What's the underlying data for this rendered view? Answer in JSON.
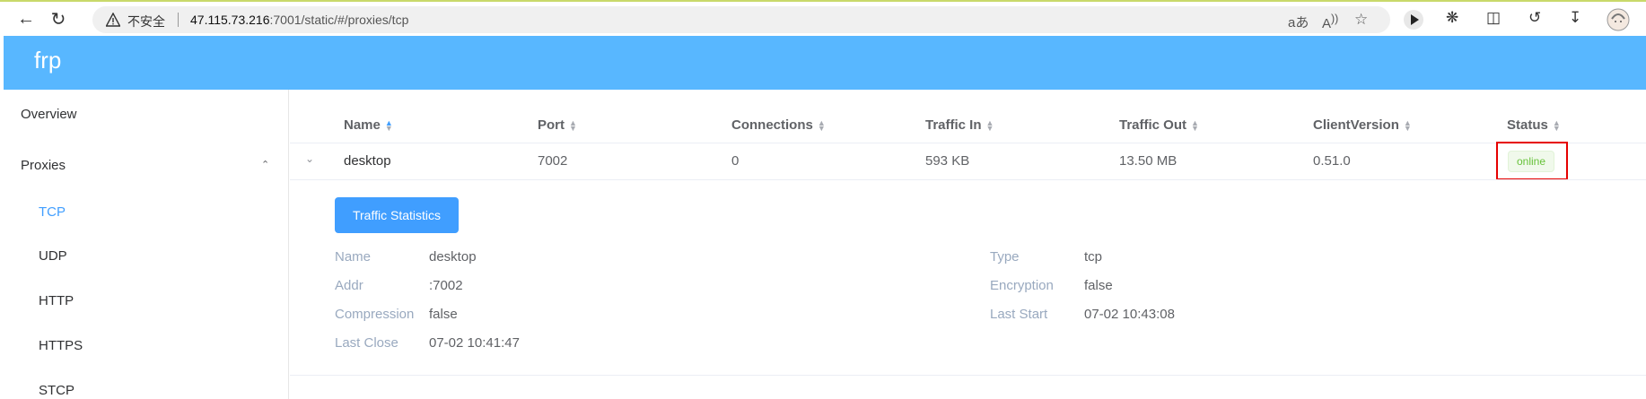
{
  "browser": {
    "insecure_label": "不安全",
    "url_host": "47.115.73.216",
    "url_rest": ":7001/static/#/proxies/tcp",
    "read_aloud_label": "aあ",
    "reader_label": "A",
    "icons": [
      "back-icon",
      "refresh-icon",
      "warning-icon",
      "translate-icon",
      "read-aloud-icon",
      "favorite-star-icon",
      "play-icon",
      "extensions-icon",
      "split-screen-icon",
      "history-icon",
      "download-icon",
      "profile-avatar"
    ]
  },
  "app": {
    "brand": "frp",
    "header_color": "#58b7ff"
  },
  "sidebar": {
    "overview": "Overview",
    "proxies": "Proxies",
    "items": [
      "TCP",
      "UDP",
      "HTTP",
      "HTTPS",
      "STCP"
    ],
    "active": "TCP",
    "accent": "#409eff"
  },
  "table": {
    "headers": [
      "Name",
      "Port",
      "Connections",
      "Traffic In",
      "Traffic Out",
      "ClientVersion",
      "Status"
    ],
    "sorted_column": "Name",
    "rows": [
      {
        "name": "desktop",
        "port": "7002",
        "connections": "0",
        "traffic_in": "593 KB",
        "traffic_out": "13.50 MB",
        "client_version": "0.51.0",
        "status": "online"
      }
    ]
  },
  "detail": {
    "button": "Traffic Statistics",
    "left": [
      {
        "label": "Name",
        "value": "desktop"
      },
      {
        "label": "Addr",
        "value": ":7002"
      },
      {
        "label": "Compression",
        "value": "false"
      },
      {
        "label": "Last Close",
        "value": "07-02 10:41:47"
      }
    ],
    "right": [
      {
        "label": "Type",
        "value": "tcp"
      },
      {
        "label": "Encryption",
        "value": "false"
      },
      {
        "label": "Last Start",
        "value": "07-02 10:43:08"
      }
    ]
  },
  "colors": {
    "status_online": "#67c23a",
    "highlight": "#e60000"
  }
}
